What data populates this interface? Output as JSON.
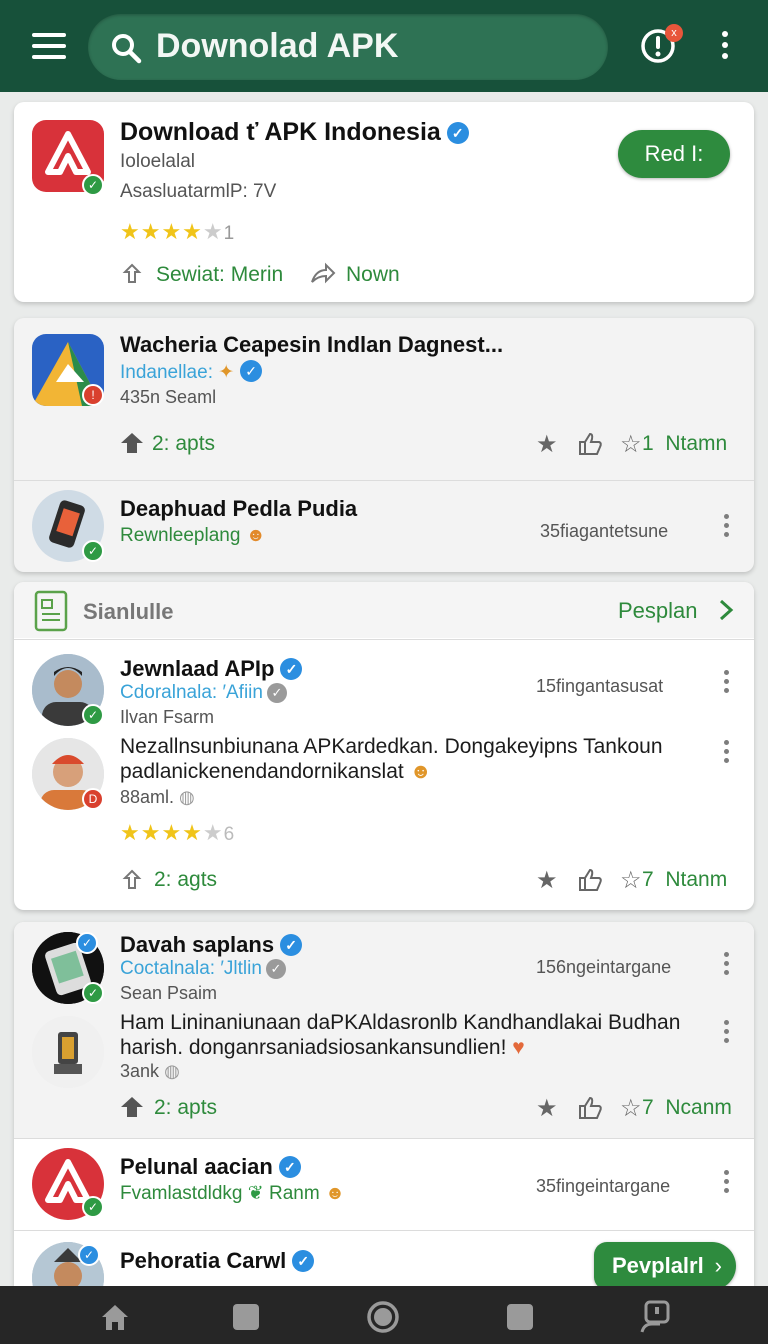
{
  "topbar": {
    "search_text": "Downolad APK",
    "alert_badge": "x",
    "icons": [
      "menu-icon",
      "search-icon",
      "alert-icon",
      "more-vertical-icon"
    ]
  },
  "featured": {
    "title": "Download ť APK Indonesia",
    "line1": "Ioloelalal",
    "line2": "AsasluatarmlP: 7V",
    "rating": "1",
    "action1": "Sewiat: Merin",
    "action2": "Nown",
    "button": "Red I:"
  },
  "card2": {
    "row1": {
      "title": "Wacheria Ceapesin Indlan Dagnest...",
      "subtitle": "Indanellae:",
      "meta": "435n Seaml",
      "count": "2: apts",
      "stat": "1",
      "stat_label": "Ntamn"
    },
    "row2": {
      "title": "Deaphuad Pedla Pudia",
      "subtitle": "Rewnleeplang",
      "time": "35fiagantetsune"
    }
  },
  "section": {
    "title": "Sianlulle",
    "link": "Pesplan",
    "post1": {
      "name": "Jewnlaad APIp",
      "handle": "Cdoralnala: ′Afiin",
      "meta": "Ilvan Fsarm",
      "time": "15fingantasusat"
    },
    "post2": {
      "text": "Nezallnsunbiunana APKardedkan. Dongakeyipns Tankoun padlanickenendandornikanslat",
      "meta": "88aml.",
      "rating": "6",
      "count": "2: agts",
      "stat": "7",
      "stat_label": "Ntanm"
    }
  },
  "card4": {
    "post1": {
      "name": "Davah saplans",
      "handle": "Coctalnala: ′Jltlin",
      "meta": "Sean Psaim",
      "time": "156ngeintargane"
    },
    "post2": {
      "text": "Ham Lininaniunaan daPKAldasronlb Kandhandlakai Budhan harish. donganrsaniadsiosankansundlien!",
      "meta": "3ank",
      "count": "2: apts",
      "stat": "7",
      "stat_label": "Ncanm"
    },
    "row3": {
      "title": "Pelunal aacian",
      "subtitle": "Fvamlastdldkg",
      "extra": "Ranm",
      "time": "35fingeintargane"
    },
    "row4": {
      "title": "Pehoratia Carwl",
      "button": "Pevplalrl"
    }
  },
  "bottom_nav": [
    "home-icon",
    "square-icon",
    "circle-icon",
    "square-icon",
    "profile-icon"
  ]
}
